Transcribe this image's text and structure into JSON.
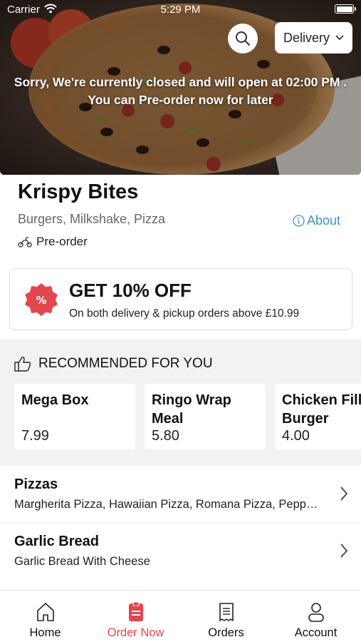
{
  "status_bar": {
    "carrier": "Carrier",
    "time": "5:29 PM"
  },
  "hero": {
    "closed_line1": "Sorry, We're currently closed and will open at 02:00 PM .",
    "closed_line2": "You can Pre-order now for later",
    "delivery_label": "Delivery"
  },
  "restaurant": {
    "name": "Krispy Bites",
    "tags": "Burgers, Milkshake, Pizza",
    "about_label": "About",
    "preorder_label": "Pre-order"
  },
  "offer": {
    "title": "GET 10% OFF",
    "subtitle": "On both delivery & pickup orders above £10.99"
  },
  "recommended": {
    "heading": "RECOMMENDED FOR YOU",
    "items": [
      {
        "name_line1": "Mega Box",
        "name_line2": "",
        "price": "7.99"
      },
      {
        "name_line1": "Ringo Wrap",
        "name_line2": "Meal",
        "price": "5.80"
      },
      {
        "name_line1": "Chicken Fill",
        "name_line2": "Burger",
        "price": "4.00"
      }
    ]
  },
  "categories": [
    {
      "name": "Pizzas",
      "desc": "Margherita Pizza, Hawaiian Pizza, Romana Pizza, Pepp…"
    },
    {
      "name": "Garlic Bread",
      "desc": "Garlic Bread With Cheese"
    }
  ],
  "tabs": [
    {
      "label": "Home",
      "icon": "home-icon"
    },
    {
      "label": "Order Now",
      "icon": "order-icon"
    },
    {
      "label": "Orders",
      "icon": "receipt-icon"
    },
    {
      "label": "Account",
      "icon": "person-icon"
    }
  ],
  "colors": {
    "accent": "#e2474f",
    "link": "#3a93c9",
    "section_bg": "#f2f2f2"
  }
}
